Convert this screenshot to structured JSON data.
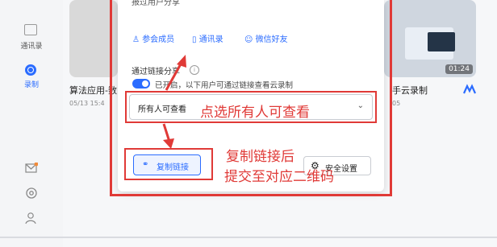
{
  "sidebar": {
    "contacts_label": "通讯录",
    "record_label": "录制"
  },
  "cards": {
    "left_title": "算法应用-数",
    "left_date": "05/13 15:4",
    "right_title": "手云录制",
    "right_date": "05",
    "right_duration": "01:24"
  },
  "popup": {
    "top_partial_label": "报过用户分享",
    "member_options": [
      "参会成员",
      "通讯录",
      "微信好友"
    ],
    "link_share_label": "通过链接分享",
    "switch_text": "已开启，以下用户可通过链接查看云录制",
    "select_value": "所有人可查看",
    "copy_link_label": "复制链接",
    "security_label": "安全设置"
  },
  "annotations": {
    "select_hint": "点选所有人可查看",
    "copy_hint_line1": "复制链接后",
    "copy_hint_line2": "提交至对应二维码",
    "accent_color": "#e03a37"
  }
}
